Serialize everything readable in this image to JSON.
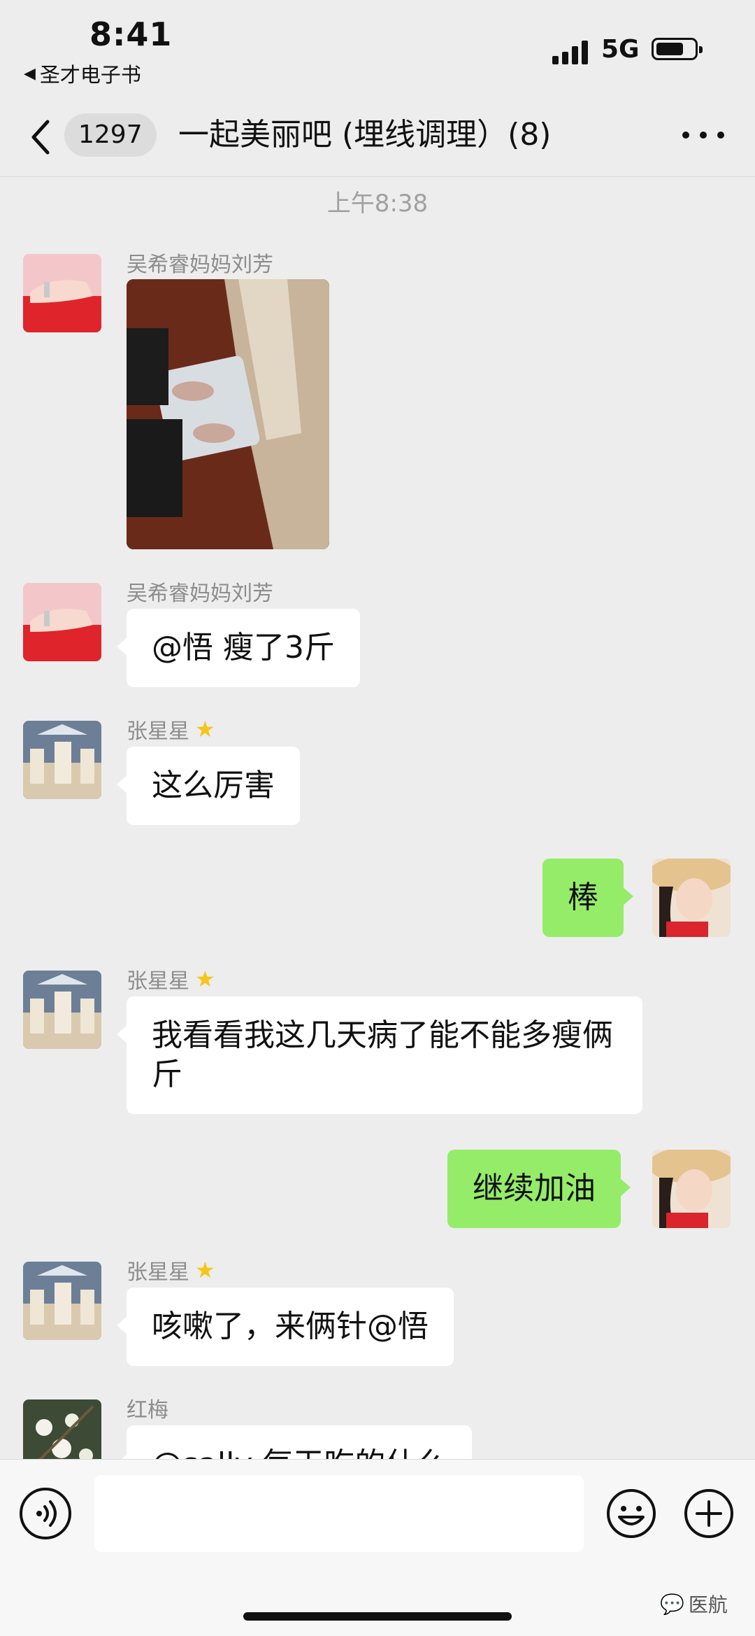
{
  "status_bar": {
    "time": "8:41",
    "back_app": "圣才电子书",
    "network": "5G"
  },
  "nav": {
    "unread_count": "1297",
    "title": "一起美丽吧 (埋线调理）(8)"
  },
  "timestamp": "上午8:38",
  "messages": [
    {
      "sender": "吴希睿妈妈刘芳",
      "type": "image"
    },
    {
      "sender": "吴希睿妈妈刘芳",
      "text": "@悟 瘦了3斤"
    },
    {
      "sender": "张星星",
      "text": "这么厉害",
      "badge": "star"
    },
    {
      "sender": "",
      "text": "棒",
      "outgoing": true
    },
    {
      "sender": "张星星",
      "text": "我看看我这几天病了能不能多瘦俩斤",
      "badge": "star"
    },
    {
      "sender": "",
      "text": "继续加油",
      "outgoing": true
    },
    {
      "sender": "张星星",
      "text": "咳嗽了，来俩针@悟",
      "badge": "star"
    },
    {
      "sender": "红梅",
      "text": "@sally 每天吃的什么"
    }
  ],
  "input_bar": {
    "placeholder": ""
  },
  "watermark": "医航",
  "colors": {
    "background": "#ededed",
    "outgoing_bubble": "#95ec69",
    "incoming_bubble": "#ffffff"
  }
}
